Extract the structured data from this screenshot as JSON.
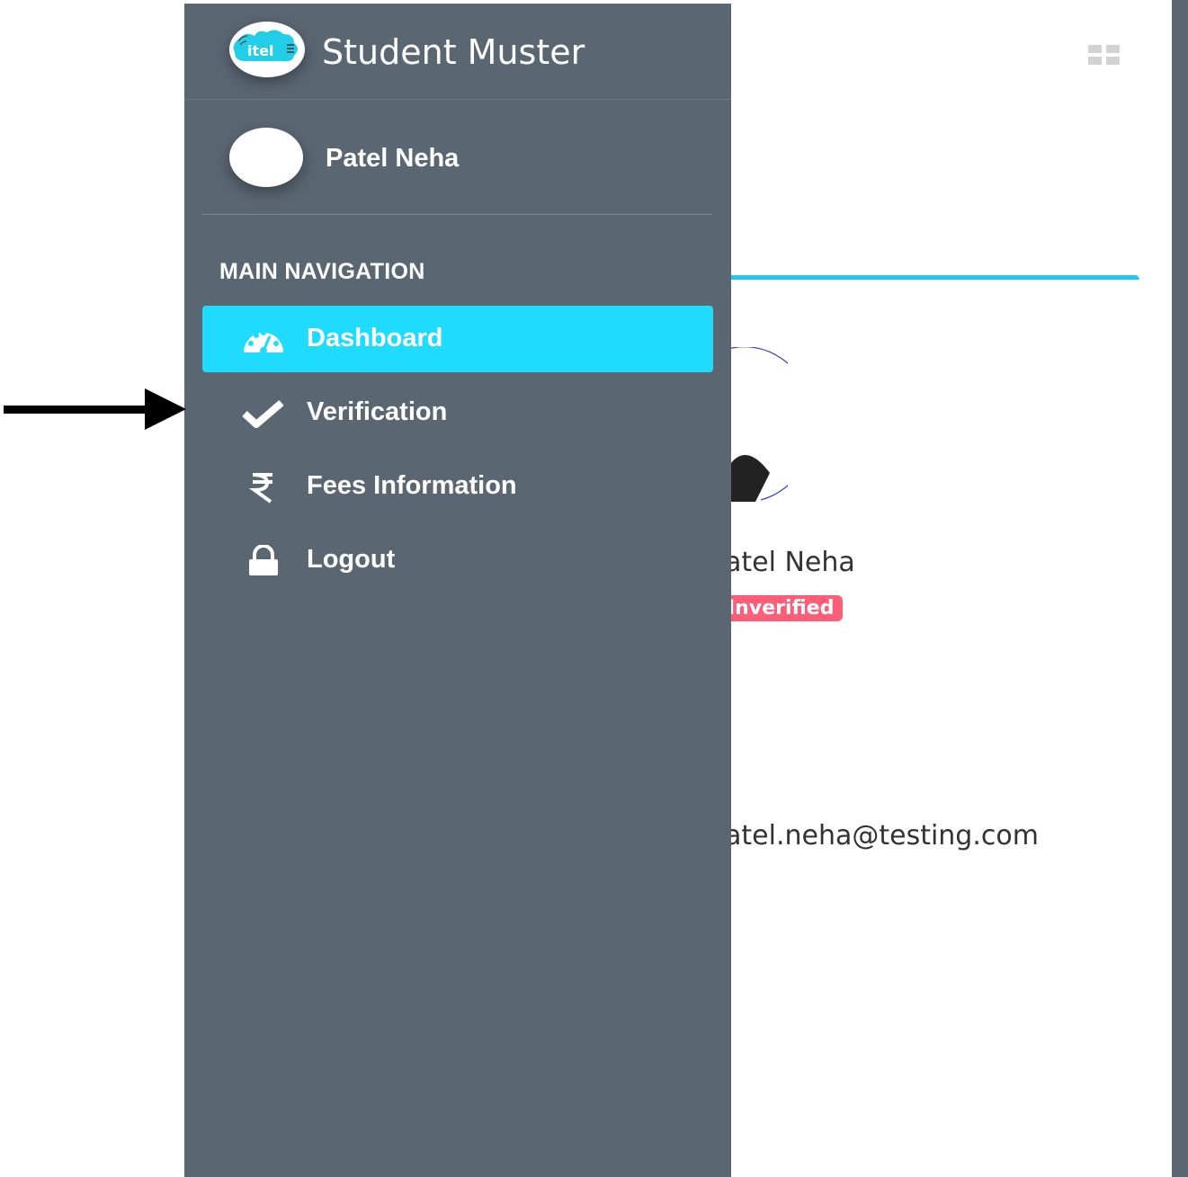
{
  "sidebar": {
    "brand": {
      "title": "Student Muster",
      "logo_text": "itel"
    },
    "user": {
      "name": "Patel Neha"
    },
    "nav_header": "MAIN NAVIGATION",
    "items": [
      {
        "label": "Dashboard",
        "icon": "dashboard-gauge-icon",
        "active": true
      },
      {
        "label": "Verification",
        "icon": "checkmark-icon",
        "active": false
      },
      {
        "label": "Fees Information",
        "icon": "rupee-icon",
        "active": false
      },
      {
        "label": "Logout",
        "icon": "lock-icon",
        "active": false
      }
    ]
  },
  "main": {
    "profile_name": "atel Neha",
    "status_badge": "Inverified",
    "email": "atel.neha@testing.com"
  },
  "colors": {
    "sidebar_bg": "#5b6673",
    "active_item": "#1fdcff",
    "accent_line": "#1fc8f0",
    "badge": "#ff5c77"
  }
}
